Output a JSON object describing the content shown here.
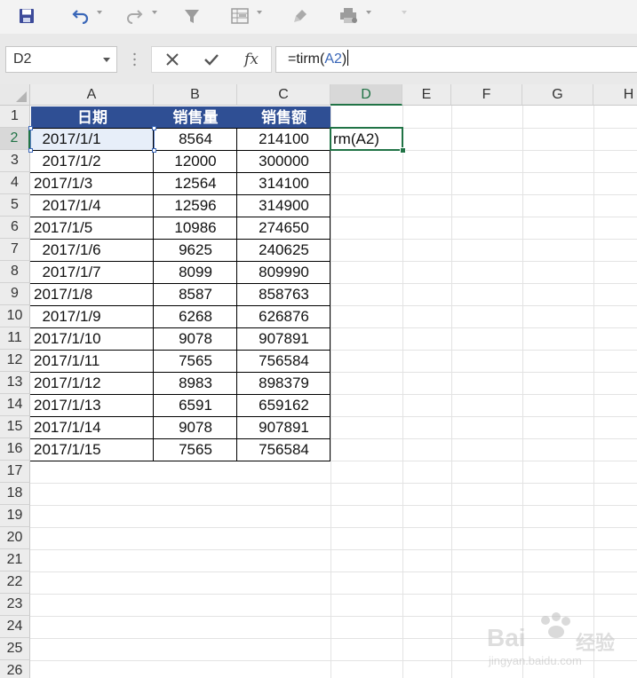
{
  "name_box": {
    "value": "D2"
  },
  "formula_bar": {
    "prefix": "=tirm(",
    "ref": "A2",
    "suffix": ")",
    "cancel_icon": "x-icon",
    "enter_icon": "check-icon",
    "fx_label": "fx"
  },
  "toolbar": {
    "icons": [
      "save-icon",
      "undo-icon",
      "redo-icon",
      "filter-icon",
      "table-format-icon",
      "format-painter-icon",
      "printer-settings-icon"
    ]
  },
  "columns": [
    "A",
    "B",
    "C",
    "D",
    "E",
    "F",
    "G",
    "H"
  ],
  "rows": [
    "1",
    "2",
    "3",
    "4",
    "5",
    "6",
    "7",
    "8",
    "9",
    "10",
    "11",
    "12",
    "13",
    "14",
    "15",
    "16",
    "17",
    "18",
    "19",
    "20",
    "21",
    "22",
    "23",
    "24",
    "25",
    "26"
  ],
  "table": {
    "headers": [
      "日期",
      "销售量",
      "销售额"
    ],
    "data": [
      [
        "  2017/1/1",
        "8564",
        "214100"
      ],
      [
        "  2017/1/2",
        "12000",
        "300000"
      ],
      [
        "2017/1/3",
        "12564",
        "314100"
      ],
      [
        "  2017/1/4",
        "12596",
        "314900"
      ],
      [
        "2017/1/5",
        "10986",
        "274650"
      ],
      [
        "  2017/1/6",
        "9625",
        "240625"
      ],
      [
        "  2017/1/7",
        "8099",
        "809990"
      ],
      [
        "2017/1/8",
        "8587",
        "858763"
      ],
      [
        "  2017/1/9",
        "6268",
        "626876"
      ],
      [
        "2017/1/10",
        "9078",
        "907891"
      ],
      [
        "2017/1/11",
        "7565",
        "756584"
      ],
      [
        "2017/1/12",
        "8983",
        "898379"
      ],
      [
        "2017/1/13",
        "6591",
        "659162"
      ],
      [
        "2017/1/14",
        "9078",
        "907891"
      ],
      [
        "2017/1/15",
        "7565",
        "756584"
      ]
    ]
  },
  "d2_value": "rm(A2)",
  "watermark": {
    "brand": "Bai",
    "brand2": "经验",
    "url": "jingyan.baidu.com"
  },
  "colors": {
    "header_fill": "#2f4f94",
    "selection_green": "#217346",
    "ref_blue": "#3a67b8"
  }
}
